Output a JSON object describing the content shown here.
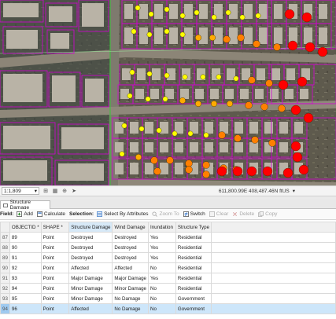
{
  "map": {
    "scale": "1:1,809",
    "coordinates": "611,800.99E 408,487.46N ftUS",
    "dot_colors": {
      "destroyed": "#ff0000",
      "major_damage": "#ff7f00",
      "minor_damage": "#ffaa00",
      "affected": "#ffff00",
      "parcel_outline": "#d500d5"
    },
    "icons": [
      "grid-icon",
      "table-icon",
      "pin-icon",
      "navigate-icon"
    ]
  },
  "table": {
    "tab_label": "Structure Damage",
    "toolbar": {
      "field_label": "Field:",
      "add": "Add",
      "calculate": "Calculate",
      "selection_label": "Selection:",
      "select_by_attributes": "Select By Attributes",
      "zoom_to": "Zoom To",
      "switch": "Switch",
      "clear": "Clear",
      "delete": "Delete",
      "copy": "Copy"
    },
    "columns": [
      "OBJECTID *",
      "SHAPE *",
      "Structure Damage",
      "Wind Damage",
      "Inundation",
      "Structure Type"
    ],
    "rows": [
      {
        "n": "87",
        "id": "89",
        "shape": "Point",
        "damage": "Destroyed",
        "wind": "Destroyed",
        "inund": "Yes",
        "type": "Residential"
      },
      {
        "n": "88",
        "id": "90",
        "shape": "Point",
        "damage": "Destroyed",
        "wind": "Destroyed",
        "inund": "Yes",
        "type": "Residential"
      },
      {
        "n": "89",
        "id": "91",
        "shape": "Point",
        "damage": "Destroyed",
        "wind": "Destroyed",
        "inund": "Yes",
        "type": "Residential"
      },
      {
        "n": "90",
        "id": "92",
        "shape": "Point",
        "damage": "Affected",
        "wind": "Affected",
        "inund": "No",
        "type": "Residential"
      },
      {
        "n": "91",
        "id": "93",
        "shape": "Point",
        "damage": "Major Damage",
        "wind": "Major Damage",
        "inund": "Yes",
        "type": "Residential"
      },
      {
        "n": "92",
        "id": "94",
        "shape": "Point",
        "damage": "Minor Damage",
        "wind": "Minor Damage",
        "inund": "No",
        "type": "Residential"
      },
      {
        "n": "93",
        "id": "95",
        "shape": "Point",
        "damage": "Minor Damage",
        "wind": "No Damage",
        "inund": "No",
        "type": "Government"
      },
      {
        "n": "94",
        "id": "96",
        "shape": "Point",
        "damage": "Affected",
        "wind": "No Damage",
        "inund": "No",
        "type": "Government"
      }
    ],
    "selected_row_index": 7
  }
}
